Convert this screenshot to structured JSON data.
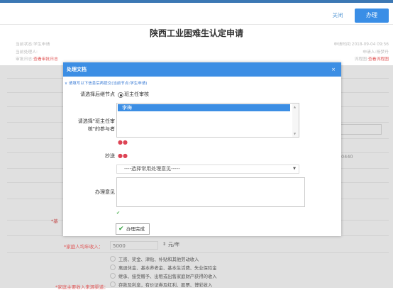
{
  "toolbar": {
    "close_label": "关闭",
    "handle_label": "办理"
  },
  "form": {
    "title": "陕西工业困难生认定申请",
    "meta_left": [
      "当前状态:学生申请",
      "当前处理人:",
      "审批日志:"
    ],
    "approval_log_link": "查看审批日志",
    "meta_right": [
      "申请时间:2018-09-04 09:56",
      "申请人:杨梦丹",
      "流程图:"
    ],
    "flowchart_link": "查看流程图",
    "bg_fragment": "0440",
    "bg_label_fragment": "*基",
    "income_label": "*家庭人均年收入：",
    "income_value": "5000",
    "income_unit": "元/年",
    "income_sources_label": "*家庭主要收入来源渠道：",
    "income_options": [
      "工资、奖金、津贴、补贴和其他劳动收入",
      "离退休金、基本养老金、基本生活费、失业保险金",
      "继承、接受赠予、出租或出售家庭财产获得的收入",
      "存款及利息，有价证券及红利、股票、博彩收入"
    ]
  },
  "dialog": {
    "title": "处理文档",
    "close": "×",
    "tip": "∨ 请填写以下信息后再提交(当前节点:学生申请)",
    "next_node_label": "请选择后继节点",
    "next_node_option": "班主任审核",
    "participant_label_1": "请选择\"班主任审",
    "participant_label_2": "核\"的参与者",
    "participant_selected": "李梅",
    "cc_label": "抄送",
    "opinion_select_text": "----选择常用处理意见-----",
    "opinion_label": "办理意见",
    "done_button": "办理完成"
  },
  "icons": {
    "person_icon": "person-group-icon",
    "check_icon": "green-check-icon"
  }
}
